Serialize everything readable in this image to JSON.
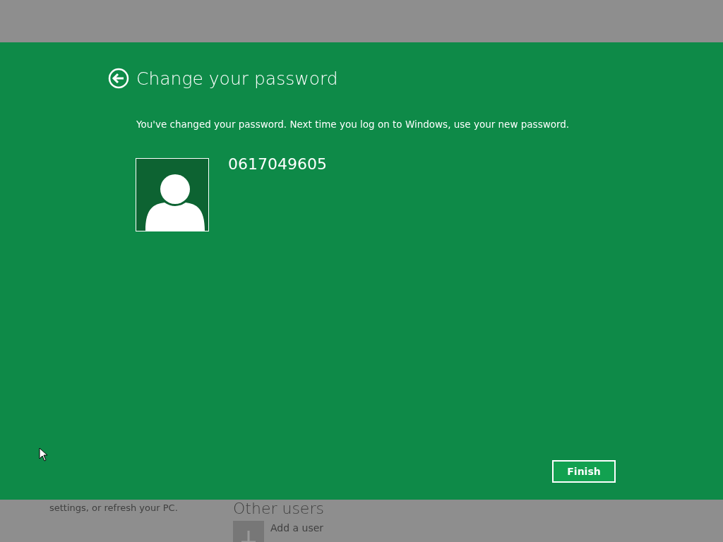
{
  "dialog": {
    "title": "Change your password",
    "message": "You've changed your password. Next time you log on to Windows, use your new password.",
    "user_name": "0617049605",
    "buttons": [
      "Finish"
    ]
  },
  "background": {
    "left_text": "settings, or refresh your PC.",
    "section_title": "Other users",
    "add_user_label": "Add a user"
  }
}
